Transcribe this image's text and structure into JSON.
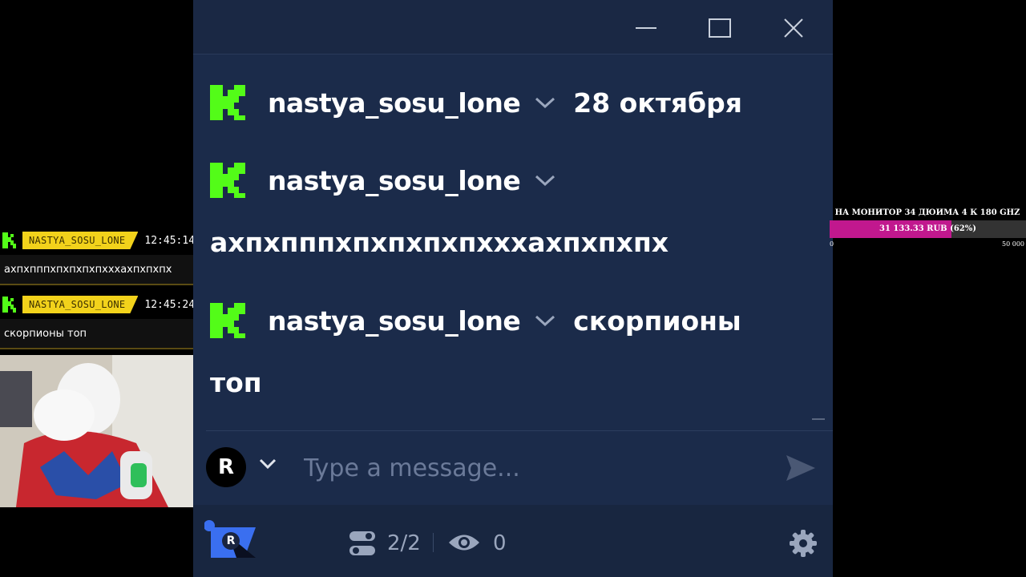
{
  "overlay": {
    "messages": [
      {
        "name": "NASTYA_SOSU_LONE",
        "time": "12:45:14",
        "text": "ахпхпппхпхпхпхпхххахпхпхпх"
      },
      {
        "name": "NASTYA_SOSU_LONE",
        "time": "12:45:24",
        "text": "скорпионы топ"
      }
    ]
  },
  "chat": {
    "messages": [
      {
        "username": "nastya_sosu_lone",
        "inline_text": "28 октября",
        "text": ""
      },
      {
        "username": "nastya_sosu_lone",
        "inline_text": "",
        "text": "ахпхпппхпхпхпхпхххахпхпхпх"
      },
      {
        "username": "nastya_sosu_lone",
        "inline_text": "скорпионы",
        "text": "топ"
      }
    ],
    "input_placeholder": "Type a message...",
    "avatar_letter": "R",
    "brand_color": "#53fc18"
  },
  "footer": {
    "logo_letter": "R",
    "streams": "2/2",
    "viewers": "0"
  },
  "goal": {
    "title": "НА МОНИТОР 34 ДЮИМА 4 К 180 GHZ",
    "progress_text": "31 133.33 RUB (62%)",
    "progress_fraction": 0.62,
    "min_label": "0",
    "max_label": "50 000",
    "bar_color": "#c1188e"
  }
}
